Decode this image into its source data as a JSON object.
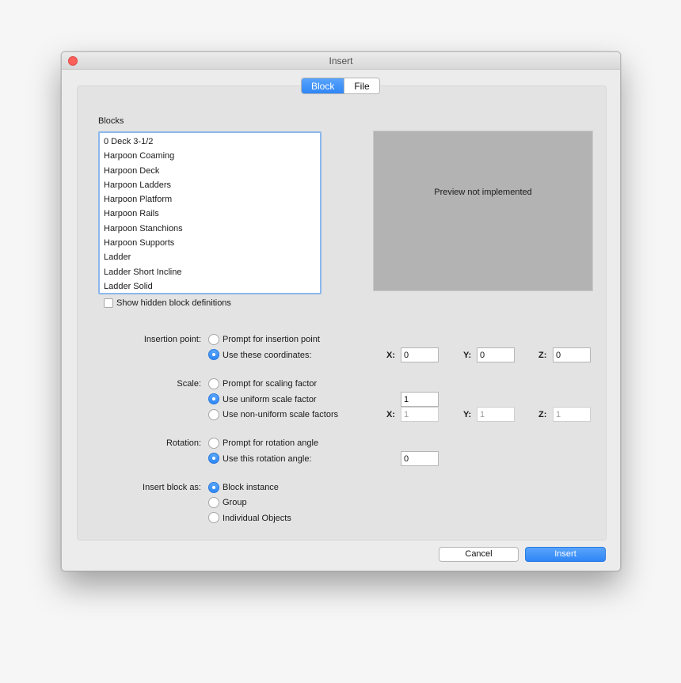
{
  "window": {
    "title": "Insert"
  },
  "tabs": [
    {
      "label": "Block",
      "active": true
    },
    {
      "label": "File",
      "active": false
    }
  ],
  "blocks": {
    "label": "Blocks",
    "items": [
      "0 Deck 3-1/2",
      "Harpoon Coaming",
      "Harpoon Deck",
      "Harpoon Ladders",
      "Harpoon Platform",
      "Harpoon Rails",
      "Harpoon Stanchions",
      "Harpoon Supports",
      "Ladder",
      "Ladder Short Incline",
      "Ladder Solid"
    ],
    "show_hidden_label": "Show hidden block definitions",
    "show_hidden_checked": false
  },
  "preview": {
    "text": "Preview not implemented"
  },
  "insertion_point": {
    "label": "Insertion point:",
    "option_prompt": "Prompt for insertion point",
    "option_coords": "Use these coordinates:",
    "x_label": "X:",
    "y_label": "Y:",
    "z_label": "Z:",
    "x": "0",
    "y": "0",
    "z": "0"
  },
  "scale": {
    "label": "Scale:",
    "option_prompt": "Prompt for scaling factor",
    "option_uniform": "Use uniform scale factor",
    "option_nonuniform": "Use non-uniform scale factors",
    "uniform_value": "1",
    "x_label": "X:",
    "y_label": "Y:",
    "z_label": "Z:",
    "x": "1",
    "y": "1",
    "z": "1"
  },
  "rotation": {
    "label": "Rotation:",
    "option_prompt": "Prompt for rotation angle",
    "option_angle": "Use this rotation angle:",
    "angle": "0"
  },
  "insert_as": {
    "label": "Insert block as:",
    "option_instance": "Block instance",
    "option_group": "Group",
    "option_objects": "Individual Objects"
  },
  "buttons": {
    "cancel": "Cancel",
    "insert": "Insert"
  },
  "colors": {
    "accent": "#2f86f6",
    "close": "#fc605b",
    "preview_bg": "#b3b3b3"
  }
}
